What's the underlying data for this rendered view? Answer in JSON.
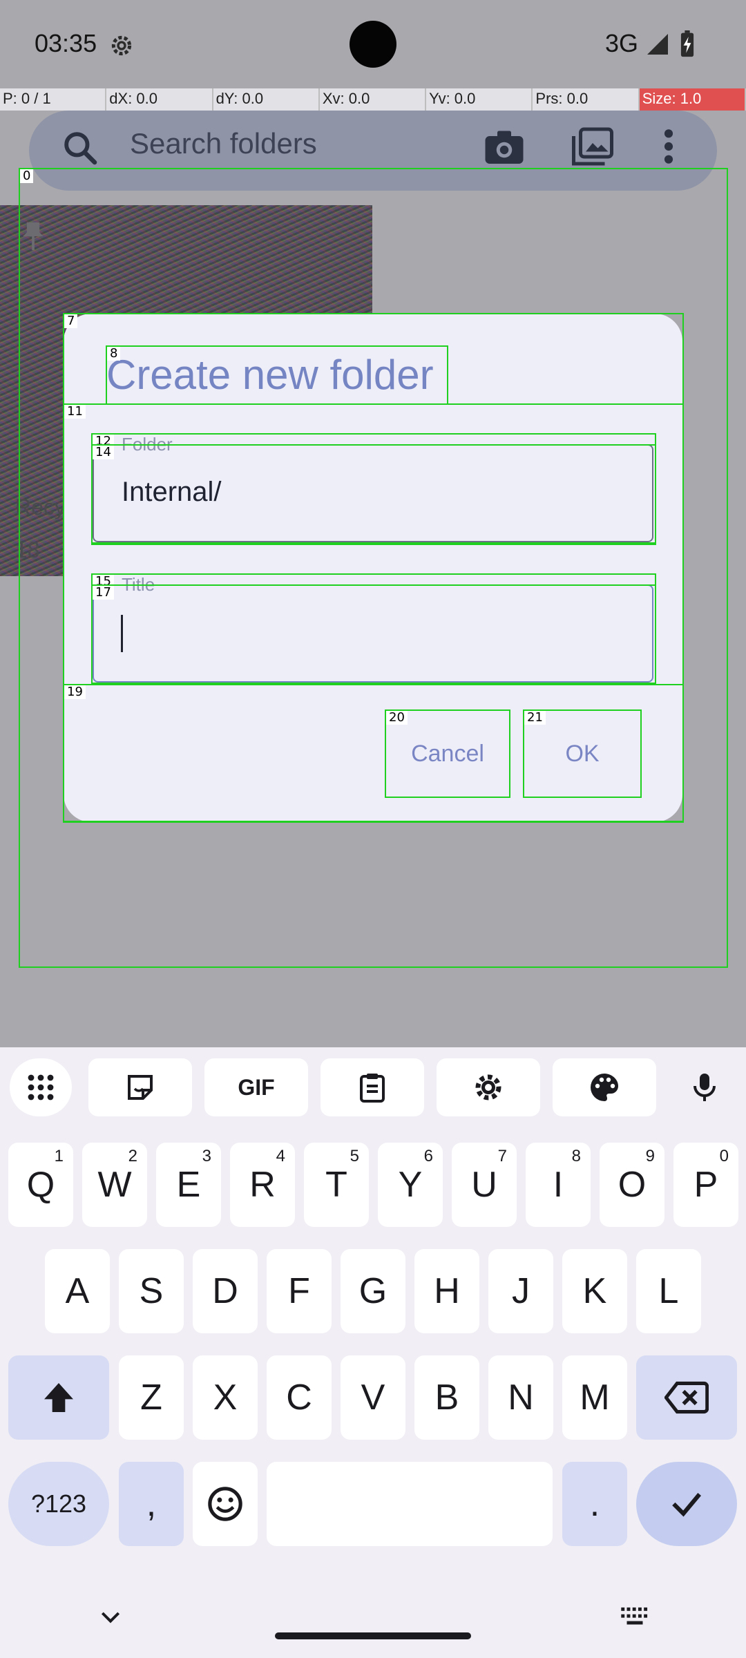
{
  "status_bar": {
    "time": "03:35",
    "network": "3G",
    "icons": [
      "settings-icon",
      "signal-icon",
      "battery-charging-icon"
    ]
  },
  "debug_overlay": {
    "cells": [
      "P: 0 / 1",
      "dX: 0.0",
      "dY: 0.0",
      "Xv: 0.0",
      "Yv: 0.0",
      "Prs: 0.0",
      "Size: 1.0"
    ]
  },
  "background_app": {
    "search_placeholder": "Search folders",
    "icons": [
      "search-icon",
      "camera-icon",
      "gallery-icon",
      "more-vert-icon",
      "pin-icon"
    ],
    "folder_card": {
      "name": "Recy",
      "count": "18"
    }
  },
  "dialog": {
    "title": "Create new folder",
    "folder_field": {
      "label": "Folder",
      "value": "Internal/"
    },
    "title_field": {
      "label": "Title",
      "value": ""
    },
    "cancel_label": "Cancel",
    "ok_label": "OK"
  },
  "debug_boxes": {
    "tags": [
      "0",
      "7",
      "8",
      "11",
      "12",
      "14",
      "15",
      "17",
      "19",
      "20",
      "21"
    ]
  },
  "keyboard": {
    "toolbar": [
      "apps-grid-icon",
      "sticker-icon",
      "gif-icon",
      "clipboard-icon",
      "settings-icon",
      "palette-icon",
      "mic-icon"
    ],
    "gif_label": "GIF",
    "row1": [
      {
        "key": "Q",
        "hint": "1"
      },
      {
        "key": "W",
        "hint": "2"
      },
      {
        "key": "E",
        "hint": "3"
      },
      {
        "key": "R",
        "hint": "4"
      },
      {
        "key": "T",
        "hint": "5"
      },
      {
        "key": "Y",
        "hint": "6"
      },
      {
        "key": "U",
        "hint": "7"
      },
      {
        "key": "I",
        "hint": "8"
      },
      {
        "key": "O",
        "hint": "9"
      },
      {
        "key": "P",
        "hint": "0"
      }
    ],
    "row2": [
      "A",
      "S",
      "D",
      "F",
      "G",
      "H",
      "J",
      "K",
      "L"
    ],
    "row3": [
      "Z",
      "X",
      "C",
      "V",
      "B",
      "N",
      "M"
    ],
    "symbols_label": "?123",
    "comma": ",",
    "period": ".",
    "bottom_icons": [
      "shift-icon",
      "backspace-icon",
      "emoji-icon",
      "enter-check-icon",
      "hide-keyboard-icon",
      "keyboard-switch-icon"
    ]
  },
  "colors": {
    "accent": "#7584c2",
    "debug_green": "#20d020",
    "debug_red": "#e05050",
    "dialog_bg": "#eeeef9"
  }
}
